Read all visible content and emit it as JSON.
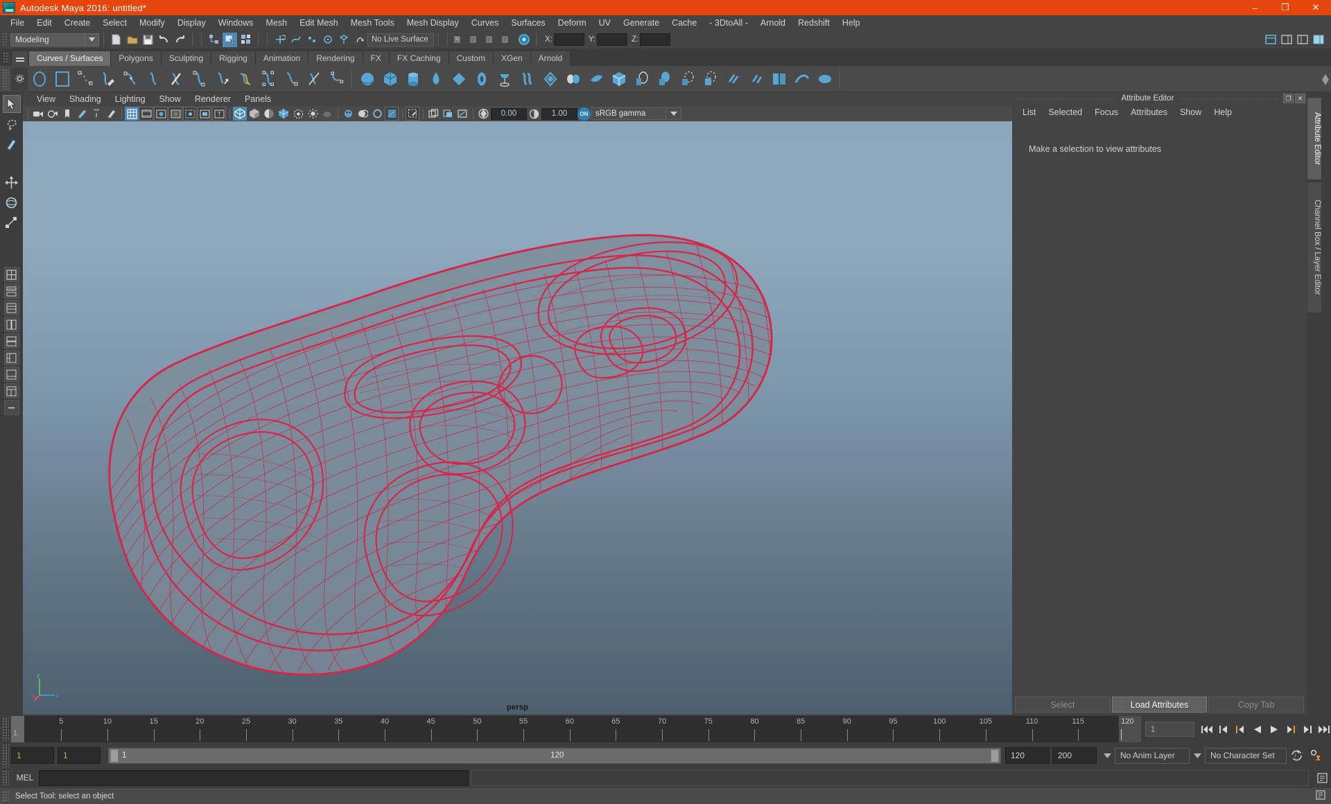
{
  "window": {
    "title": "Autodesk Maya 2016: untitled*",
    "minimize": "–",
    "maximize": "❐",
    "close": "✕",
    "accent_color": "#e8450c"
  },
  "menubar": {
    "items": [
      "File",
      "Edit",
      "Create",
      "Select",
      "Modify",
      "Display",
      "Windows",
      "Mesh",
      "Edit Mesh",
      "Mesh Tools",
      "Mesh Display",
      "Curves",
      "Surfaces",
      "Deform",
      "UV",
      "Generate",
      "Cache",
      "- 3DtoAll -",
      "Arnold",
      "Redshift",
      "Help"
    ]
  },
  "statusbar": {
    "menuset": "Modeling",
    "live_surface": "No Live Surface",
    "axis_labels": [
      "X:",
      "Y:",
      "Z:"
    ],
    "axis_values": [
      "",
      "",
      ""
    ],
    "icons": [
      "new-scene-icon",
      "open-scene-icon",
      "save-scene-icon",
      "undo-icon",
      "redo-icon",
      "select-by-hierarchy-icon",
      "select-by-object-icon",
      "select-by-component-icon",
      "snap-to-grid-icon",
      "snap-to-curve-icon",
      "snap-to-point-icon",
      "snap-to-projected-icon",
      "snap-to-view-plane-icon",
      "make-live-icon"
    ],
    "right_icons": [
      "show-hide-modeling-toolkit-icon",
      "show-hide-attribute-editor-icon",
      "show-hide-tool-settings-icon",
      "show-hide-channel-box-icon"
    ]
  },
  "shelf": {
    "tabs": [
      "Curves / Surfaces",
      "Polygons",
      "Sculpting",
      "Rigging",
      "Animation",
      "Rendering",
      "FX",
      "FX Caching",
      "Custom",
      "XGen",
      "Arnold"
    ],
    "active_tab": "Curves / Surfaces",
    "curve_icons": [
      "nurbs-circle-icon",
      "nurbs-square-icon",
      "ep-curve-tool-icon",
      "pencil-curve-tool-icon",
      "three-point-arc-icon",
      "attach-curves-icon",
      "detach-curves-icon",
      "insert-knot-icon",
      "extend-curve-icon",
      "offset-curve-icon",
      "rebuild-curve-icon",
      "curve-fillet-icon",
      "cut-curve-icon",
      "curve-editing-tool-icon"
    ],
    "surface_icons": [
      "nurbs-sphere-icon",
      "nurbs-cube-icon",
      "nurbs-cylinder-icon",
      "nurbs-cone-icon",
      "nurbs-plane-icon",
      "nurbs-torus-icon",
      "revolve-icon",
      "loft-icon",
      "planar-icon",
      "extrude-icon",
      "birail-icon",
      "boundary-icon",
      "square-surface-icon",
      "bevel-icon",
      "bevel-plus-icon",
      "intersect-surfaces-icon",
      "trim-tool-icon",
      "attach-surfaces-icon",
      "detach-surfaces-icon",
      "align-surfaces-icon",
      "surface-fillet-icon",
      "sculpt-geometry-icon"
    ]
  },
  "toolbox": {
    "tools": [
      {
        "name": "select-tool",
        "selected": true
      },
      {
        "name": "lasso-select-tool",
        "selected": false
      },
      {
        "name": "paint-select-tool",
        "selected": false
      },
      {
        "name": "move-tool",
        "selected": false
      },
      {
        "name": "rotate-tool",
        "selected": false
      },
      {
        "name": "scale-tool",
        "selected": false
      }
    ],
    "layouts": [
      "single-perspective-layout",
      "four-view-layout",
      "persp-outliner-layout",
      "persp-graph-layout",
      "persp-hypershade-layout",
      "persp-relationship-layout",
      "two-pane-layout",
      "three-pane-layout",
      "saved-layout"
    ]
  },
  "viewport": {
    "menus": [
      "View",
      "Shading",
      "Lighting",
      "Show",
      "Renderer",
      "Panels"
    ],
    "camera_label": "persp",
    "exposure": "0.00",
    "gamma": "1.00",
    "color_management": "sRGB gamma",
    "color_management_toggle": "ON",
    "toolbar_icons": [
      "select-camera-icon",
      "bookmark-icon",
      "image-plane-icon",
      "2d-pan-zoom-icon",
      "grease-pencil-icon",
      "grid-icon",
      "film-gate-icon",
      "resolution-gate-icon",
      "gate-mask-icon",
      "xray-joints-icon",
      "xray-active-components-icon",
      "texture-placement-icon",
      "wireframe-shading-icon",
      "smooth-shade-all-icon",
      "smooth-shade-selected-icon",
      "flat-shade-icon",
      "wireframe-on-shaded-icon",
      "use-default-lighting-icon",
      "shadows-icon",
      "screen-space-ao-icon",
      "motion-blur-icon",
      "multisample-icon",
      "isolate-select-icon",
      "display-layer-icon",
      "panel-zoom-icon",
      "exposure-icon",
      "contrast-icon"
    ],
    "axis_names": [
      "x",
      "y",
      "z"
    ]
  },
  "attribute_editor": {
    "title": "Attribute Editor",
    "menus": [
      "List",
      "Selected",
      "Focus",
      "Attributes",
      "Show",
      "Help"
    ],
    "message": "Make a selection to view attributes",
    "buttons": [
      {
        "label": "Select",
        "active": false
      },
      {
        "label": "Load Attributes",
        "active": true
      },
      {
        "label": "Copy Tab",
        "active": false
      }
    ],
    "restore_icon": "❐",
    "close_icon": "✕"
  },
  "dock_tabs": [
    {
      "label": "Attribute Editor",
      "active": true
    },
    {
      "label": "Channel Box / Layer Editor",
      "active": false
    }
  ],
  "timeline": {
    "current_frame": "1",
    "start": "1",
    "end": "120",
    "ticks": [
      5,
      10,
      15,
      20,
      25,
      30,
      35,
      40,
      45,
      50,
      55,
      60,
      65,
      70,
      75,
      80,
      85,
      90,
      95,
      100,
      105,
      110,
      115,
      120
    ],
    "frame_field": "1",
    "playback_buttons": [
      "go-to-start-icon",
      "step-back-keyframe-icon",
      "step-back-frame-icon",
      "play-backwards-icon",
      "play-forwards-icon",
      "step-forward-frame-icon",
      "step-forward-keyframe-icon",
      "go-to-end-icon"
    ]
  },
  "range_slider": {
    "anim_start": "1",
    "playback_start": "1",
    "bar_start_label": "1",
    "bar_end_label": "120",
    "playback_end": "120",
    "anim_end": "200",
    "anim_layer": "No Anim Layer",
    "character_set": "No Character Set",
    "auto_key_icon": "auto-keyframe-icon",
    "anim_prefs_icon": "animation-preferences-icon"
  },
  "command_line": {
    "language": "MEL",
    "input_value": "",
    "output_value": "",
    "script_editor_icon": "script-editor-icon"
  },
  "status_line": {
    "message": "Select Tool: select an object",
    "help_icon": "help-gear-icon"
  },
  "model": {
    "description": "Wireframe surfboard / shoe-sole shaped NURBS surface, selected",
    "wireframe_color": "#d6274b",
    "surface_color": "#7f8b97"
  }
}
